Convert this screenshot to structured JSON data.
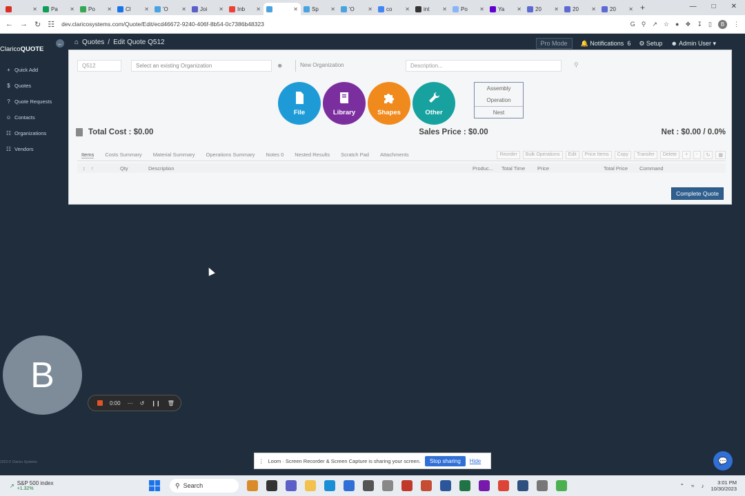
{
  "browser": {
    "tabs": [
      {
        "label": "",
        "color": "#d93025"
      },
      {
        "label": "Pa",
        "color": "#0f9d58"
      },
      {
        "label": "Po",
        "color": "#34a853"
      },
      {
        "label": "Cl",
        "color": "#1a73e8"
      },
      {
        "label": "'O",
        "color": "#4aa3df"
      },
      {
        "label": "Joi",
        "color": "#5b5fc7"
      },
      {
        "label": "Inb",
        "color": "#ea4335"
      },
      {
        "label": "",
        "color": "#4aa3df",
        "active": true
      },
      {
        "label": "Sp",
        "color": "#4aa3df"
      },
      {
        "label": "'O",
        "color": "#4aa3df"
      },
      {
        "label": "co",
        "color": "#4285f4"
      },
      {
        "label": "int",
        "color": "#333333"
      },
      {
        "label": "Po",
        "color": "#8ab4f8"
      },
      {
        "label": "Ya",
        "color": "#6001d2"
      },
      {
        "label": "20",
        "color": "#5e6ad2"
      },
      {
        "label": "20",
        "color": "#5e6ad2"
      },
      {
        "label": "20",
        "color": "#5e6ad2"
      }
    ],
    "url": "dev.claricosystems.com/Quote/Edit/ecd46672-9240-406f-8b54-0c7386b48323",
    "new_tab": "+",
    "profile_initial": "B"
  },
  "app": {
    "brand_light": "Clarico",
    "brand_bold": "QUOTE",
    "breadcrumb": [
      "Quotes",
      "Edit Quote Q512"
    ],
    "pro_mode": "Pro Mode",
    "notifications_label": "Notifications",
    "notifications_count": "6",
    "setup_label": "Setup",
    "user_label": "Admin User"
  },
  "sidebar": {
    "items": [
      {
        "icon": "+",
        "label": "Quick Add"
      },
      {
        "icon": "$",
        "label": "Quotes"
      },
      {
        "icon": "?",
        "label": "Quote Requests"
      },
      {
        "icon": "☺",
        "label": "Contacts"
      },
      {
        "icon": "☷",
        "label": "Organizations"
      },
      {
        "icon": "☷",
        "label": "Vendors"
      }
    ]
  },
  "quote": {
    "number_value": "Q512",
    "org_placeholder": "Select an existing Organization",
    "new_org_label": "New Organization",
    "description_placeholder": "Description...",
    "buttons": [
      {
        "label": "File",
        "color": "#1e9bd7"
      },
      {
        "label": "Library",
        "color": "#7b2f9e"
      },
      {
        "label": "Shapes",
        "color": "#f08a1c"
      },
      {
        "label": "Other",
        "color": "#17a2a0"
      }
    ],
    "ops": [
      "Assembly",
      "Operation",
      "Nest"
    ],
    "total_cost": "Total Cost : $0.00",
    "sales_price": "Sales Price : $0.00",
    "net": "Net : $0.00 / 0.0%",
    "tabs": [
      "Items",
      "Costs Summary",
      "Material Summary",
      "Operations Summary",
      "Notes 0",
      "Nested Results",
      "Scratch Pad",
      "Attachments"
    ],
    "toolbar": [
      "Reorder",
      "Bulk Operations",
      "Edit",
      "Price Items",
      "Copy",
      "Transfer",
      "Delete",
      "+",
      "-",
      "↻",
      "▦"
    ],
    "columns": [
      "Qty",
      "Description",
      "Produc...",
      "Total Time",
      "Price",
      "Total Price",
      "Command"
    ],
    "complete_label": "Complete Quote"
  },
  "overlay": {
    "avatar_initial": "B",
    "rec_time": "0:00",
    "share_text": "Loom · Screen Recorder & Screen Capture is sharing your screen.",
    "stop_label": "Stop sharing",
    "hide_label": "Hide",
    "footer": "2023 © Clarico Systems"
  },
  "taskbar": {
    "stock_name": "S&P 500 index",
    "stock_change": "+1.32%",
    "search_label": "Search",
    "time": "3:01 PM",
    "date": "10/30/2023"
  }
}
